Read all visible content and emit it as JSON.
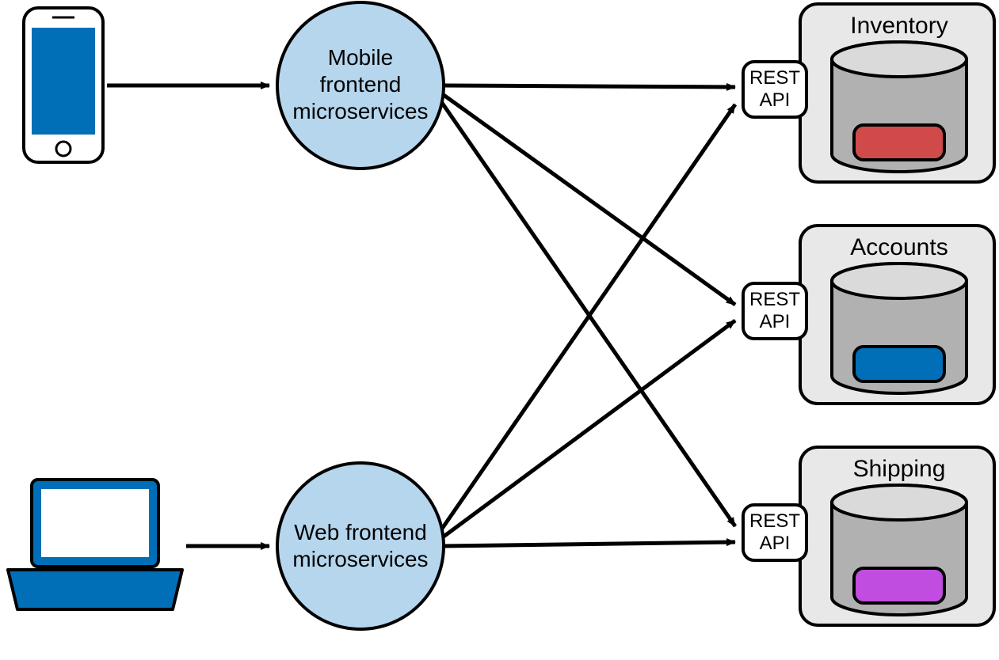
{
  "nodes": {
    "mobile_frontend": {
      "line1": "Mobile",
      "line2": "frontend",
      "line3": "microservices"
    },
    "web_frontend": {
      "line1": "Web frontend",
      "line2": "microservices"
    },
    "rest_api": {
      "line1": "REST",
      "line2": "API"
    },
    "inventory": {
      "title": "Inventory"
    },
    "accounts": {
      "title": "Accounts"
    },
    "shipping": {
      "title": "Shipping"
    }
  },
  "colors": {
    "phone_screen": "#006fb7",
    "laptop_body": "#006fb7",
    "circle_fill": "#b6d6ed",
    "db_body": "#b1b1b1",
    "db_top": "#dadada",
    "inventory_accent": "#d14a4a",
    "accounts_accent": "#006fb7",
    "shipping_accent": "#c04ce0",
    "service_box": "#e8e8e8"
  },
  "arrows": [
    {
      "from": "phone",
      "to": "mobile_frontend"
    },
    {
      "from": "laptop",
      "to": "web_frontend"
    },
    {
      "from": "mobile_frontend",
      "to": "inventory"
    },
    {
      "from": "mobile_frontend",
      "to": "accounts"
    },
    {
      "from": "mobile_frontend",
      "to": "shipping"
    },
    {
      "from": "web_frontend",
      "to": "inventory"
    },
    {
      "from": "web_frontend",
      "to": "accounts"
    },
    {
      "from": "web_frontend",
      "to": "shipping"
    }
  ]
}
